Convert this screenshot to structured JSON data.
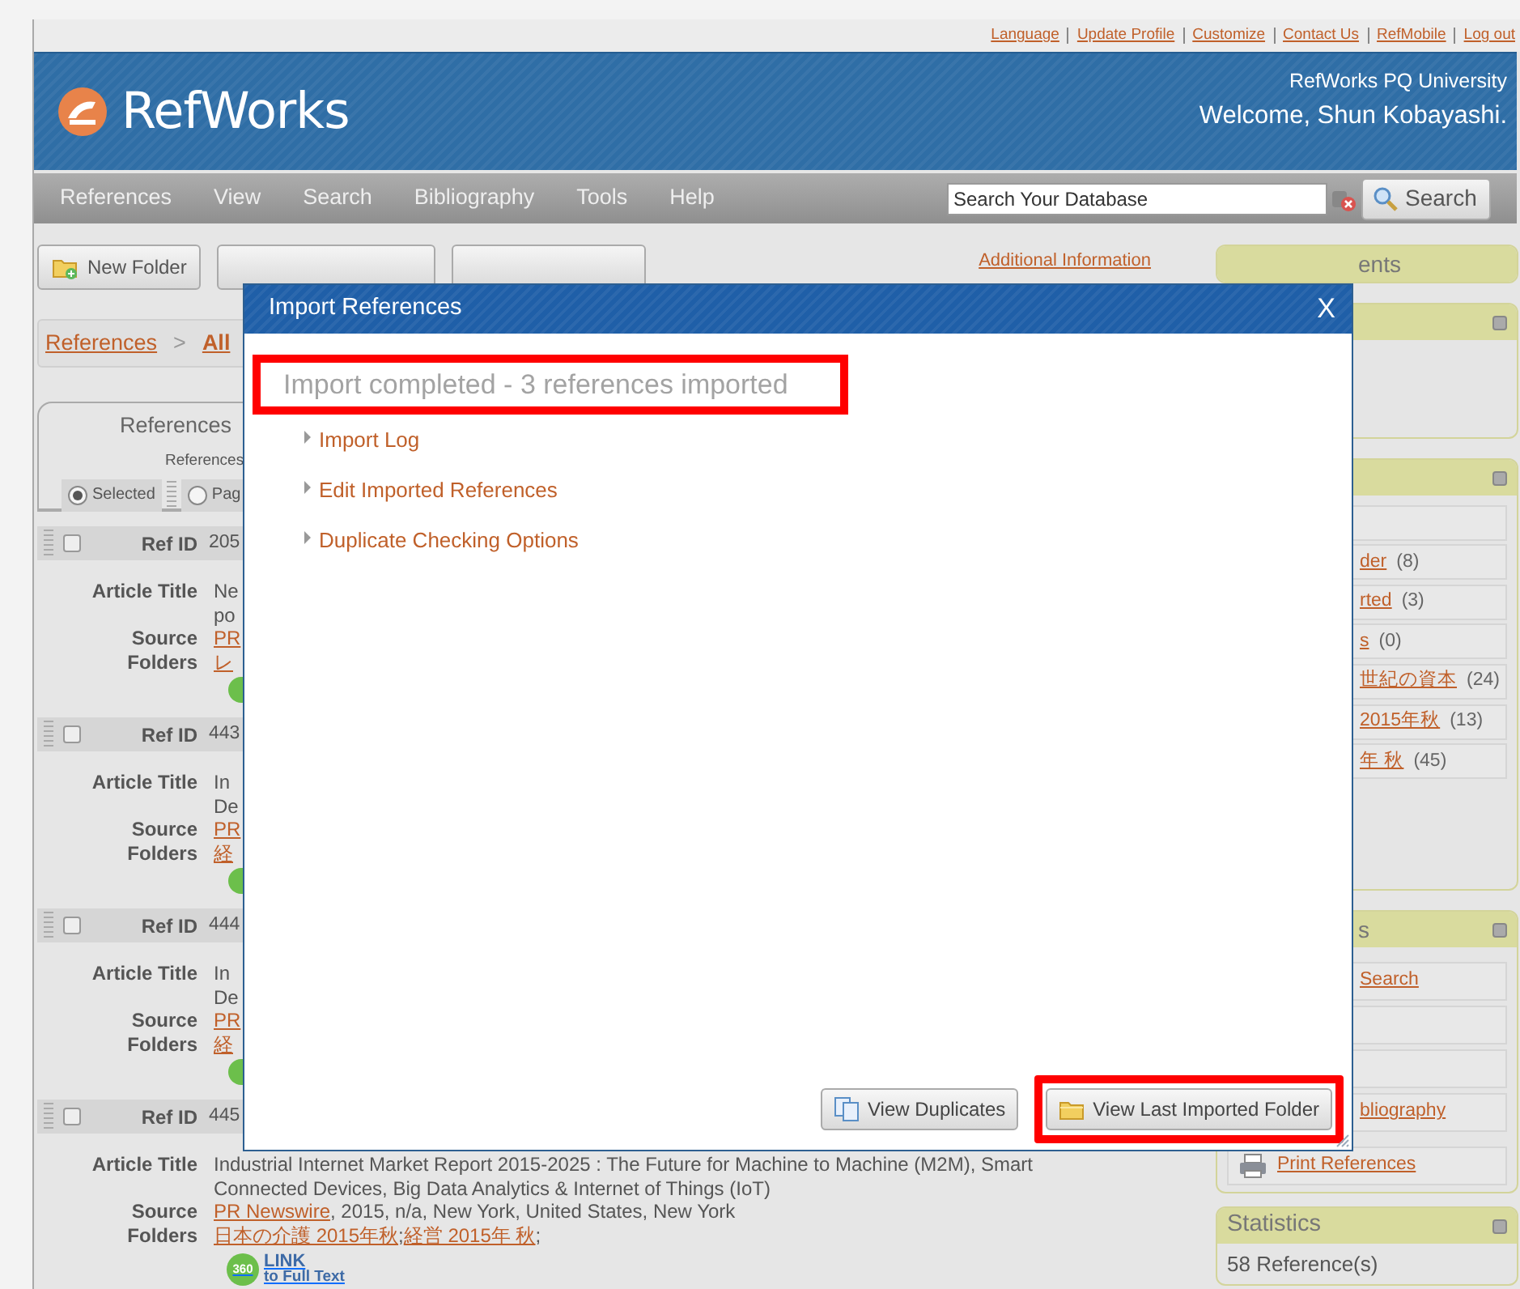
{
  "top_links": [
    "Language",
    "Update Profile",
    "Customize",
    "Contact Us",
    "RefMobile",
    "Log out"
  ],
  "header": {
    "logo": "RefWorks",
    "institution": "RefWorks PQ University",
    "welcome": "Welcome, Shun Kobayashi."
  },
  "nav": {
    "items": [
      "References",
      "View",
      "Search",
      "Bibliography",
      "Tools",
      "Help"
    ],
    "search": {
      "placeholder": "Search Your Database"
    },
    "search_button": "Search"
  },
  "toolbar": {
    "buttons": [
      "New Folder"
    ],
    "additional_info": "Additional Information"
  },
  "breadcrumb": {
    "items": [
      "References",
      "All"
    ],
    "separator": ">"
  },
  "references_panel": {
    "title": "References",
    "subtitle": "References",
    "options": [
      {
        "label": "Selected",
        "selected": true
      },
      {
        "label": "Pag",
        "selected": false
      }
    ]
  },
  "references": [
    {
      "kind": "partial",
      "checked": false,
      "id_label": "Ref ID",
      "ref_id": "205",
      "fields": [
        {
          "label": "Article Title",
          "lines": [
            [
              {
                "kind": "text",
                "text": "Ne"
              }
            ],
            [
              {
                "kind": "text",
                "text": "po"
              }
            ]
          ]
        },
        {
          "label": "Source",
          "lines": [
            [
              {
                "kind": "link",
                "text": "PR"
              }
            ]
          ]
        },
        {
          "label": "Folders",
          "lines": [
            [
              {
                "kind": "link",
                "text": "レ"
              }
            ]
          ]
        }
      ]
    },
    {
      "kind": "partial",
      "checked": false,
      "id_label": "Ref ID",
      "ref_id": "443",
      "fields": [
        {
          "label": "Article Title",
          "lines": [
            [
              {
                "kind": "text",
                "text": "In"
              }
            ],
            [
              {
                "kind": "text",
                "text": "De"
              }
            ]
          ]
        },
        {
          "label": "Source",
          "lines": [
            [
              {
                "kind": "link",
                "text": "PR"
              }
            ]
          ]
        },
        {
          "label": "Folders",
          "lines": [
            [
              {
                "kind": "link",
                "text": "経"
              }
            ]
          ]
        }
      ]
    },
    {
      "kind": "partial",
      "checked": false,
      "id_label": "Ref ID",
      "ref_id": "444",
      "fields": [
        {
          "label": "Article Title",
          "lines": [
            [
              {
                "kind": "text",
                "text": "In"
              }
            ],
            [
              {
                "kind": "text",
                "text": "De"
              }
            ]
          ]
        },
        {
          "label": "Source",
          "lines": [
            [
              {
                "kind": "link",
                "text": "PR"
              }
            ]
          ]
        },
        {
          "label": "Folders",
          "lines": [
            [
              {
                "kind": "link",
                "text": "経"
              }
            ]
          ]
        }
      ]
    },
    {
      "kind": "full",
      "checked": false,
      "id_label": "Ref ID",
      "ref_id": "445",
      "fields": [
        {
          "label": "Article Title",
          "lines": [
            [
              {
                "kind": "text",
                "text": "Industrial Internet Market Report 2015-2025 : The Future for Machine to Machine (M2M), Smart Connected Devices, Big Data Analytics & Internet of Things (IoT)"
              }
            ]
          ]
        },
        {
          "label": "Source",
          "lines": [
            [
              {
                "kind": "link",
                "text": "PR Newswire"
              },
              {
                "kind": "text",
                "text": ", 2015, n/a, New York, United States, New York"
              }
            ]
          ]
        },
        {
          "label": "Folders",
          "lines": [
            [
              {
                "kind": "link",
                "text": "日本の介護 2015年秋"
              },
              {
                "kind": "text",
                "text": ";"
              },
              {
                "kind": "link",
                "text": "経営 2015年 秋"
              },
              {
                "kind": "text",
                "text": ";"
              }
            ]
          ]
        }
      ],
      "full_text": {
        "badge": "360",
        "title": "LINK",
        "subtitle": "to Full Text"
      }
    }
  ],
  "sidebar": {
    "panels": [
      {
        "kind": "header",
        "title": "ents"
      },
      {
        "kind": "blank",
        "collapsible": true
      },
      {
        "kind": "list",
        "collapsible": true,
        "items": [
          {
            "kind": "blank"
          },
          {
            "kind": "folder",
            "label": "der",
            "count": "(8)"
          },
          {
            "kind": "folder",
            "label": "rted",
            "count": "(3)"
          },
          {
            "kind": "folder",
            "label": "s",
            "count": "(0)"
          },
          {
            "kind": "folder",
            "label": "世紀の資本",
            "count": "(24)"
          },
          {
            "kind": "folder",
            "label": "2015年秋",
            "count": "(13)"
          },
          {
            "kind": "folder",
            "label": "年 秋",
            "count": "(45)"
          }
        ]
      },
      {
        "kind": "list",
        "title": "s",
        "collapsible": true,
        "items": [
          {
            "kind": "link",
            "label": "Search"
          },
          {
            "kind": "blank"
          },
          {
            "kind": "blank"
          },
          {
            "kind": "link",
            "label": "bliography"
          },
          {
            "kind": "print",
            "label": "Print References"
          }
        ]
      },
      {
        "kind": "stats",
        "title": "Statistics",
        "collapsible": true,
        "lines": [
          "58 Reference(s)"
        ]
      }
    ]
  },
  "modal": {
    "title": "Import References",
    "close": "X",
    "status": {
      "text": "Import completed - 3 references imported",
      "highlighted": true
    },
    "links": [
      "Import Log",
      "Edit Imported References",
      "Duplicate Checking Options"
    ],
    "buttons": [
      {
        "kind": "duplicates",
        "label": "View Duplicates",
        "highlighted": false
      },
      {
        "kind": "folder",
        "label": "View Last Imported Folder",
        "highlighted": true
      }
    ]
  }
}
